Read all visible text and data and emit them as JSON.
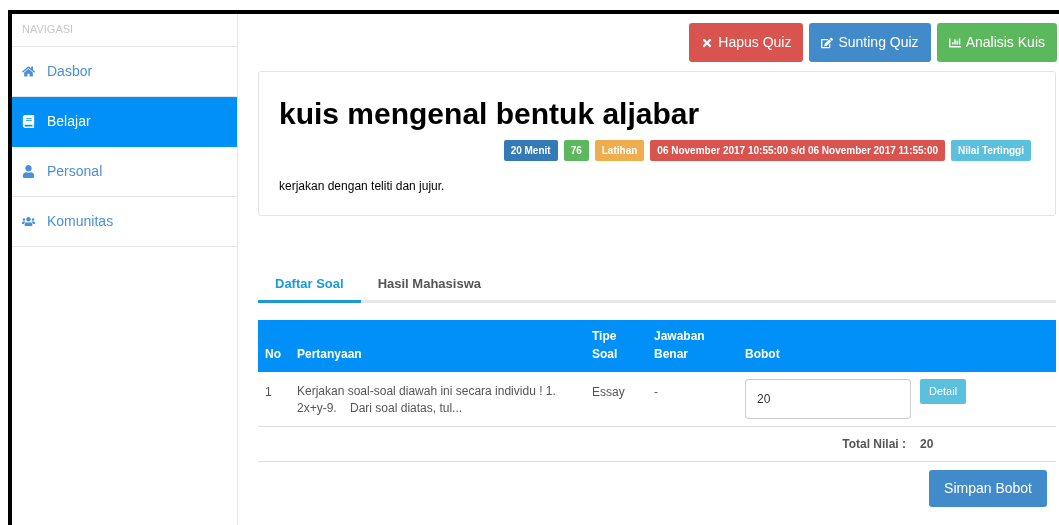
{
  "sidebar": {
    "heading": "NAVIGASI",
    "items": [
      {
        "label": "Dasbor",
        "kind": "home",
        "selected": false
      },
      {
        "label": "Belajar",
        "kind": "book",
        "selected": true
      },
      {
        "label": "Personal",
        "kind": "user",
        "selected": false
      },
      {
        "label": "Komunitas",
        "kind": "users",
        "selected": false
      }
    ]
  },
  "actions": [
    {
      "label": "Hapus Quiz",
      "kind": "delete"
    },
    {
      "label": "Sunting Quiz",
      "kind": "edit"
    },
    {
      "label": "Analisis Kuis",
      "kind": "chart"
    }
  ],
  "quiz": {
    "title": "kuis mengenal bentuk aljabar",
    "badges": [
      {
        "text": "20 Menit",
        "color": "#337ab7"
      },
      {
        "text": "76",
        "color": "#5cb85c"
      },
      {
        "text": "Latihan",
        "color": "#f0ad4e"
      },
      {
        "text": "06 November 2017 10:55:00 s/d 06 November 2017 11:55:00",
        "color": "#d9534f"
      },
      {
        "text": "Nilai Tertinggi",
        "color": "#5bc0de"
      }
    ],
    "description": "kerjakan dengan teliti dan jujur."
  },
  "tabs": [
    {
      "label": "Daftar Soal",
      "selected": true
    },
    {
      "label": "Hasil Mahasiswa",
      "selected": false
    }
  ],
  "table": {
    "columns": [
      "No",
      "Pertanyaan",
      "Tipe Soal",
      "Jawaban Benar",
      "Bobot"
    ],
    "rows": [
      {
        "no": "1",
        "question": "Kerjakan soal-soal diawah ini secara individu ! 1. 2x+y-9.    Dari soal diatas, tul...",
        "type": "Essay",
        "answer": "-",
        "weight": "20",
        "action": "Detail"
      }
    ],
    "total_label": "Total Nilai :",
    "total": "20"
  },
  "save_button": "Simpan Bobot"
}
